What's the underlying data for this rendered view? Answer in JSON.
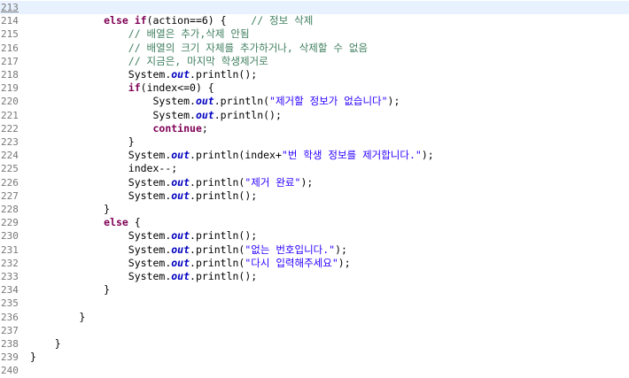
{
  "editor": {
    "current_line": 213,
    "colors": {
      "keyword": "#7f0055",
      "comment": "#3f7f5f",
      "string": "#2a00ff",
      "field": "#0000c0",
      "line_number": "#787878",
      "current_line_bg": "#e8f2fe"
    },
    "lines": [
      {
        "num": "213",
        "tokens": []
      },
      {
        "num": "214",
        "tokens": [
          {
            "t": "ws",
            "v": "            "
          },
          {
            "t": "kw",
            "v": "else if"
          },
          {
            "t": "id",
            "v": "(action==6) {    "
          },
          {
            "t": "cm",
            "v": "// 정보 삭제"
          }
        ]
      },
      {
        "num": "215",
        "tokens": [
          {
            "t": "ws",
            "v": "                "
          },
          {
            "t": "cm",
            "v": "// 배열은 추가,삭제 안됨"
          }
        ]
      },
      {
        "num": "216",
        "tokens": [
          {
            "t": "ws",
            "v": "                "
          },
          {
            "t": "cm",
            "v": "// 배열의 크기 자체를 추가하거나, 삭제할 수 없음"
          }
        ]
      },
      {
        "num": "217",
        "tokens": [
          {
            "t": "ws",
            "v": "                "
          },
          {
            "t": "cm",
            "v": "// 지금은, 마지막 학생제거로"
          }
        ]
      },
      {
        "num": "218",
        "tokens": [
          {
            "t": "ws",
            "v": "                "
          },
          {
            "t": "id",
            "v": "System."
          },
          {
            "t": "fld",
            "v": "out"
          },
          {
            "t": "id",
            "v": ".println();"
          }
        ]
      },
      {
        "num": "219",
        "tokens": [
          {
            "t": "ws",
            "v": "                "
          },
          {
            "t": "kw",
            "v": "if"
          },
          {
            "t": "id",
            "v": "(index<=0) {"
          }
        ]
      },
      {
        "num": "220",
        "tokens": [
          {
            "t": "ws",
            "v": "                    "
          },
          {
            "t": "id",
            "v": "System."
          },
          {
            "t": "fld",
            "v": "out"
          },
          {
            "t": "id",
            "v": ".println("
          },
          {
            "t": "str",
            "v": "\"제거할 정보가 없습니다\""
          },
          {
            "t": "id",
            "v": ");"
          }
        ]
      },
      {
        "num": "221",
        "tokens": [
          {
            "t": "ws",
            "v": "                    "
          },
          {
            "t": "id",
            "v": "System."
          },
          {
            "t": "fld",
            "v": "out"
          },
          {
            "t": "id",
            "v": ".println();"
          }
        ]
      },
      {
        "num": "222",
        "tokens": [
          {
            "t": "ws",
            "v": "                    "
          },
          {
            "t": "kw",
            "v": "continue"
          },
          {
            "t": "id",
            "v": ";"
          }
        ]
      },
      {
        "num": "223",
        "tokens": [
          {
            "t": "ws",
            "v": "                "
          },
          {
            "t": "id",
            "v": "}"
          }
        ]
      },
      {
        "num": "224",
        "tokens": [
          {
            "t": "ws",
            "v": "                "
          },
          {
            "t": "id",
            "v": "System."
          },
          {
            "t": "fld",
            "v": "out"
          },
          {
            "t": "id",
            "v": ".println(index+"
          },
          {
            "t": "str",
            "v": "\"번 학생 정보를 제거합니다.\""
          },
          {
            "t": "id",
            "v": ");"
          }
        ]
      },
      {
        "num": "225",
        "tokens": [
          {
            "t": "ws",
            "v": "                "
          },
          {
            "t": "id",
            "v": "index--;"
          }
        ]
      },
      {
        "num": "226",
        "tokens": [
          {
            "t": "ws",
            "v": "                "
          },
          {
            "t": "id",
            "v": "System."
          },
          {
            "t": "fld",
            "v": "out"
          },
          {
            "t": "id",
            "v": ".println("
          },
          {
            "t": "str",
            "v": "\"제거 완료\""
          },
          {
            "t": "id",
            "v": ");"
          }
        ]
      },
      {
        "num": "227",
        "tokens": [
          {
            "t": "ws",
            "v": "                "
          },
          {
            "t": "id",
            "v": "System."
          },
          {
            "t": "fld",
            "v": "out"
          },
          {
            "t": "id",
            "v": ".println();"
          }
        ]
      },
      {
        "num": "228",
        "tokens": [
          {
            "t": "ws",
            "v": "            "
          },
          {
            "t": "id",
            "v": "}"
          }
        ]
      },
      {
        "num": "229",
        "tokens": [
          {
            "t": "ws",
            "v": "            "
          },
          {
            "t": "kw",
            "v": "else"
          },
          {
            "t": "id",
            "v": " {"
          }
        ]
      },
      {
        "num": "230",
        "tokens": [
          {
            "t": "ws",
            "v": "                "
          },
          {
            "t": "id",
            "v": "System."
          },
          {
            "t": "fld",
            "v": "out"
          },
          {
            "t": "id",
            "v": ".println();"
          }
        ]
      },
      {
        "num": "231",
        "tokens": [
          {
            "t": "ws",
            "v": "                "
          },
          {
            "t": "id",
            "v": "System."
          },
          {
            "t": "fld",
            "v": "out"
          },
          {
            "t": "id",
            "v": ".println("
          },
          {
            "t": "str",
            "v": "\"없는 번호입니다.\""
          },
          {
            "t": "id",
            "v": ");"
          }
        ]
      },
      {
        "num": "232",
        "tokens": [
          {
            "t": "ws",
            "v": "                "
          },
          {
            "t": "id",
            "v": "System."
          },
          {
            "t": "fld",
            "v": "out"
          },
          {
            "t": "id",
            "v": ".println("
          },
          {
            "t": "str",
            "v": "\"다시 입력해주세요\""
          },
          {
            "t": "id",
            "v": ");"
          }
        ]
      },
      {
        "num": "233",
        "tokens": [
          {
            "t": "ws",
            "v": "                "
          },
          {
            "t": "id",
            "v": "System."
          },
          {
            "t": "fld",
            "v": "out"
          },
          {
            "t": "id",
            "v": ".println();"
          }
        ]
      },
      {
        "num": "234",
        "tokens": [
          {
            "t": "ws",
            "v": "            "
          },
          {
            "t": "id",
            "v": "}"
          }
        ]
      },
      {
        "num": "235",
        "tokens": []
      },
      {
        "num": "236",
        "tokens": [
          {
            "t": "ws",
            "v": "        "
          },
          {
            "t": "id",
            "v": "}"
          }
        ]
      },
      {
        "num": "237",
        "tokens": []
      },
      {
        "num": "238",
        "tokens": [
          {
            "t": "ws",
            "v": "    "
          },
          {
            "t": "id",
            "v": "}"
          }
        ]
      },
      {
        "num": "239",
        "tokens": [
          {
            "t": "id",
            "v": "}"
          }
        ]
      },
      {
        "num": "240",
        "tokens": []
      }
    ]
  }
}
